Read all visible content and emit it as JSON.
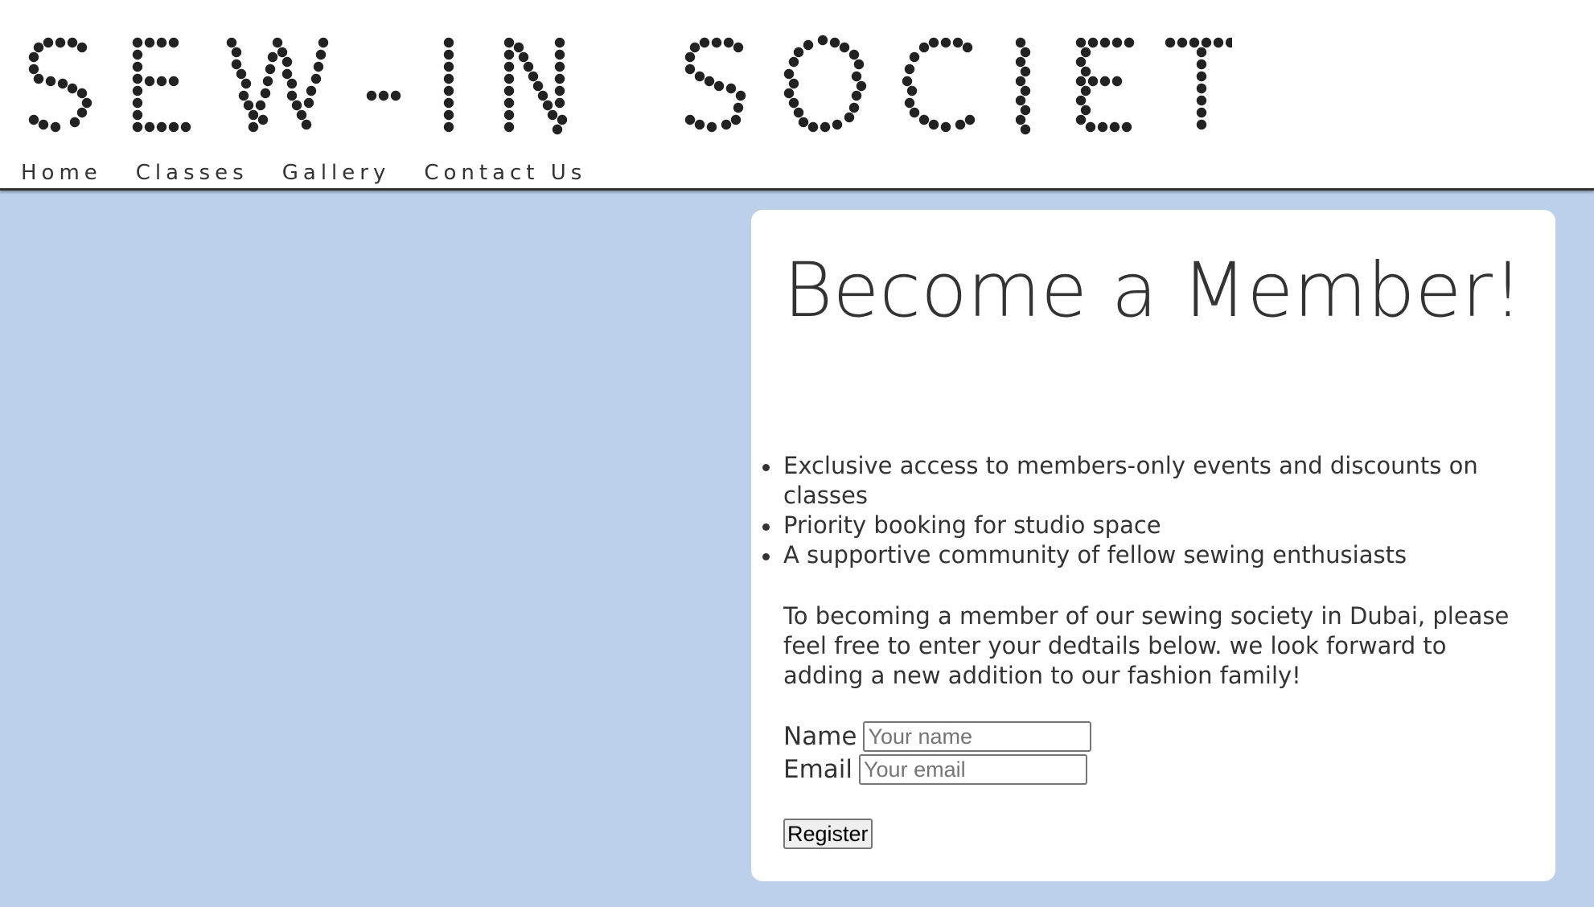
{
  "site": {
    "logo_text": "SEW-IN SOCIETY"
  },
  "nav": {
    "items": [
      "Home",
      "Classes",
      "Gallery",
      "Contact Us"
    ]
  },
  "membership": {
    "title": "Become a Member!",
    "benefits": [
      "Exclusive access to members-only events and discounts on classes",
      "Priority booking for studio space",
      "A supportive community of fellow sewing enthusiasts"
    ],
    "intro": "To becoming a member of our sewing society in Dubai, please feel free to enter your dedtails below. we look forward to adding a new addition to our fashion family!",
    "form": {
      "name_label": "Name",
      "name_placeholder": "Your name",
      "name_value": "",
      "email_label": "Email",
      "email_placeholder": "Your email",
      "email_value": "",
      "submit_label": "Register"
    }
  },
  "colors": {
    "page_background": "#bdd0ea",
    "card_background": "#ffffff",
    "text": "#333333",
    "stitch_dots": "#222222"
  }
}
